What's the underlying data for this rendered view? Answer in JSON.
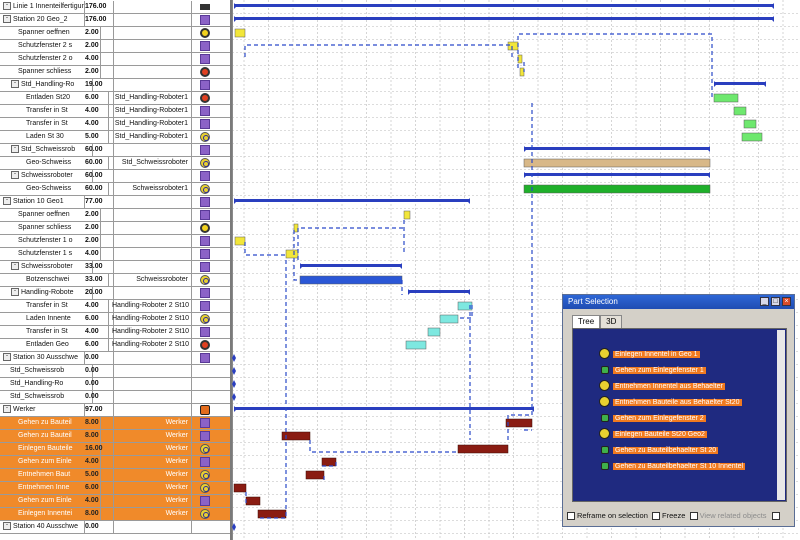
{
  "rows": [
    {
      "name": "Linie 1 Innenteilfertigun",
      "time": "176.00",
      "res": "",
      "icon": "line-icon",
      "level": 0,
      "expand": true,
      "orange": false
    },
    {
      "name": "Station 20 Geo_2",
      "time": "176.00",
      "res": "",
      "icon": "purple-block-icon",
      "level": 0,
      "expand": true,
      "orange": false
    },
    {
      "name": "Spanner oeffnen",
      "time": "2.00",
      "res": "",
      "icon": "gear-yellow-icon",
      "level": 2,
      "expand": false,
      "orange": false
    },
    {
      "name": "Schutzfenster 2 s",
      "time": "2.00",
      "res": "",
      "icon": "purple-block-icon",
      "level": 2,
      "expand": false,
      "orange": false
    },
    {
      "name": "Schutzfenster 2 o",
      "time": "4.00",
      "res": "",
      "icon": "purple-block-icon",
      "level": 2,
      "expand": false,
      "orange": false
    },
    {
      "name": "Spanner schliess",
      "time": "2.00",
      "res": "",
      "icon": "gear-red-icon",
      "level": 2,
      "expand": false,
      "orange": false
    },
    {
      "name": "Std_Handling-Ro",
      "time": "19.00",
      "res": "",
      "icon": "purple-block-icon",
      "level": 1,
      "expand": true,
      "orange": false
    },
    {
      "name": "Entladen St20",
      "time": "6.00",
      "res": "Std_Handling-Roboter1",
      "icon": "gear-red-icon",
      "level": 3,
      "expand": false,
      "orange": false
    },
    {
      "name": "Transfer in St",
      "time": "4.00",
      "res": "Std_Handling-Roboter1",
      "icon": "purple-block-icon",
      "level": 3,
      "expand": false,
      "orange": false
    },
    {
      "name": "Transfer in St",
      "time": "4.00",
      "res": "Std_Handling-Roboter1",
      "icon": "purple-block-icon",
      "level": 3,
      "expand": false,
      "orange": false
    },
    {
      "name": "Laden St 30",
      "time": "5.00",
      "res": "Std_Handling-Roboter1",
      "icon": "flow-icon",
      "level": 3,
      "expand": false,
      "orange": false
    },
    {
      "name": "Std_Schweissrob",
      "time": "60.00",
      "res": "",
      "icon": "purple-block-icon",
      "level": 1,
      "expand": true,
      "orange": false
    },
    {
      "name": "Geo-Schweiss",
      "time": "60.00",
      "res": "Std_Schweissroboter",
      "icon": "flow-icon",
      "level": 3,
      "expand": false,
      "orange": false
    },
    {
      "name": "Schweissroboter",
      "time": "60.00",
      "res": "",
      "icon": "purple-block-icon",
      "level": 1,
      "expand": true,
      "orange": false
    },
    {
      "name": "Geo-Schweiss",
      "time": "60.00",
      "res": "Schweissroboter1",
      "icon": "flow-icon",
      "level": 3,
      "expand": false,
      "orange": false
    },
    {
      "name": "Station 10 Geo1",
      "time": "77.00",
      "res": "",
      "icon": "purple-block-icon",
      "level": 0,
      "expand": true,
      "orange": false
    },
    {
      "name": "Spanner oeffnen",
      "time": "2.00",
      "res": "",
      "icon": "purple-block-icon",
      "level": 2,
      "expand": false,
      "orange": false
    },
    {
      "name": "Spanner schliess",
      "time": "2.00",
      "res": "",
      "icon": "gear-yellow-icon",
      "level": 2,
      "expand": false,
      "orange": false
    },
    {
      "name": "Schutzfenster 1 o",
      "time": "2.00",
      "res": "",
      "icon": "purple-block-icon",
      "level": 2,
      "expand": false,
      "orange": false
    },
    {
      "name": "Schutzfenster 1 s",
      "time": "4.00",
      "res": "",
      "icon": "purple-block-icon",
      "level": 2,
      "expand": false,
      "orange": false
    },
    {
      "name": "Schweissroboter",
      "time": "33.00",
      "res": "",
      "icon": "purple-block-icon",
      "level": 1,
      "expand": true,
      "orange": false
    },
    {
      "name": "Botzenschwei",
      "time": "33.00",
      "res": "Schweissroboter",
      "icon": "flow-icon",
      "level": 3,
      "expand": false,
      "orange": false
    },
    {
      "name": "Handling-Robote",
      "time": "20.00",
      "res": "",
      "icon": "purple-block-icon",
      "level": 1,
      "expand": true,
      "orange": false
    },
    {
      "name": "Transfer in St",
      "time": "4.00",
      "res": "Handling-Roboter 2 St10",
      "icon": "purple-block-icon",
      "level": 3,
      "expand": false,
      "orange": false
    },
    {
      "name": "Laden Innente",
      "time": "6.00",
      "res": "Handling-Roboter 2 St10",
      "icon": "flow-icon",
      "level": 3,
      "expand": false,
      "orange": false
    },
    {
      "name": "Transfer in St",
      "time": "4.00",
      "res": "Handling-Roboter 2 St10",
      "icon": "purple-block-icon",
      "level": 3,
      "expand": false,
      "orange": false
    },
    {
      "name": "Entladen Geo",
      "time": "6.00",
      "res": "Handling-Roboter 2 St10",
      "icon": "gear-red-icon",
      "level": 3,
      "expand": false,
      "orange": false
    },
    {
      "name": "Station 30 Ausschwe",
      "time": "0.00",
      "res": "",
      "icon": "purple-block-icon",
      "level": 0,
      "expand": true,
      "orange": false
    },
    {
      "name": "Std_Schweissrob",
      "time": "0.00",
      "res": "",
      "icon": "",
      "level": 1,
      "expand": false,
      "orange": false
    },
    {
      "name": "Std_Handling-Ro",
      "time": "0.00",
      "res": "",
      "icon": "",
      "level": 1,
      "expand": false,
      "orange": false
    },
    {
      "name": "Std_Schweissrob",
      "time": "0.00",
      "res": "",
      "icon": "",
      "level": 1,
      "expand": false,
      "orange": false
    },
    {
      "name": "Werker",
      "time": "97.00",
      "res": "",
      "icon": "robot-icon",
      "level": 0,
      "expand": true,
      "orange": false
    },
    {
      "name": "Gehen zu Bauteil",
      "time": "8.00",
      "res": "Werker",
      "icon": "purple-block-icon",
      "level": 2,
      "expand": false,
      "orange": true
    },
    {
      "name": "Gehen zu Bauteil",
      "time": "8.00",
      "res": "Werker",
      "icon": "purple-block-icon",
      "level": 2,
      "expand": false,
      "orange": true
    },
    {
      "name": "Einlegen Bauteile",
      "time": "16.00",
      "res": "Werker",
      "icon": "flow-icon",
      "level": 2,
      "expand": false,
      "orange": true
    },
    {
      "name": "Gehen zum Einle",
      "time": "4.00",
      "res": "Werker",
      "icon": "purple-block-icon",
      "level": 2,
      "expand": false,
      "orange": true
    },
    {
      "name": "Entnehmen Baut",
      "time": "5.00",
      "res": "Werker",
      "icon": "flow-icon",
      "level": 2,
      "expand": false,
      "orange": true
    },
    {
      "name": "Entnehmen Inne",
      "time": "6.00",
      "res": "Werker",
      "icon": "flow-icon",
      "level": 2,
      "expand": false,
      "orange": true
    },
    {
      "name": "Gehen zum Einle",
      "time": "4.00",
      "res": "Werker",
      "icon": "purple-block-icon",
      "level": 2,
      "expand": false,
      "orange": true
    },
    {
      "name": "Einlegen Innentei",
      "time": "8.00",
      "res": "Werker",
      "icon": "flow-icon",
      "level": 2,
      "expand": false,
      "orange": true
    },
    {
      "name": "Station 40 Ausschwe",
      "time": "0.00",
      "res": "",
      "icon": "",
      "level": 0,
      "expand": true,
      "orange": false
    }
  ],
  "colors": {
    "orange_row": "#f08a2a",
    "summary_bar": "#2a3fbf",
    "task_yellow": "#f2e63a",
    "task_green": "#6ee86e",
    "task_cyan": "#7ee8e0",
    "task_blue": "#2b57d6",
    "task_tan": "#d8b888",
    "task_darkgreen": "#1fb02a",
    "worker_bar": "#8a1c12",
    "link_line": "#2a49c9"
  },
  "part_selection": {
    "title": "Part Selection",
    "tabs": [
      "Tree",
      "3D"
    ],
    "items": [
      {
        "label": "Einlegen Innentel in Geo 1",
        "icon": "flow-icon"
      },
      {
        "label": "Gehen zum Einlegefenster 1",
        "icon": "walk-icon"
      },
      {
        "label": "Entnehmen Innentel aus Behaelter",
        "icon": "flow-icon"
      },
      {
        "label": "Entnehmen Bauteile aus Behaelter St20",
        "icon": "flow-icon"
      },
      {
        "label": "Gehen zum Einlegefenster 2",
        "icon": "walk-icon"
      },
      {
        "label": "Einlegen Bauteile St20 Geo2",
        "icon": "flow-icon"
      },
      {
        "label": "Gehen zu Bauteilbehaelter St 20",
        "icon": "walk-icon"
      },
      {
        "label": "Gehen zu Bauteilbehaelter St 10 Innentel",
        "icon": "walk-icon"
      }
    ],
    "footer": {
      "reframe": "Reframe on selection",
      "freeze": "Freeze",
      "view_related": "View related objects"
    }
  }
}
